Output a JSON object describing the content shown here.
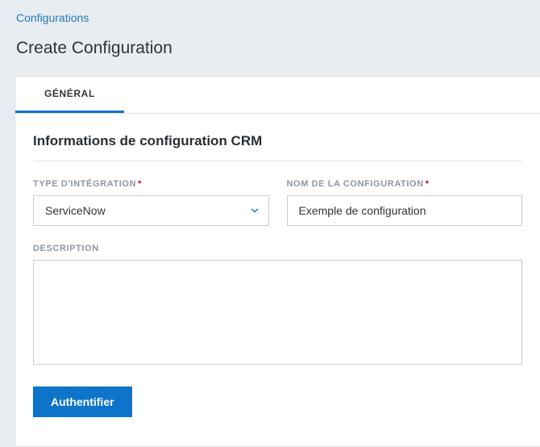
{
  "breadcrumb": {
    "label": "Configurations"
  },
  "page": {
    "title": "Create Configuration"
  },
  "tabs": {
    "general": "GÉNÉRAL"
  },
  "section": {
    "title": "Informations de configuration CRM"
  },
  "fields": {
    "integration_type": {
      "label": "TYPE D'INTÉGRATION",
      "value": "ServiceNow"
    },
    "config_name": {
      "label": "NOM DE LA CONFIGURATION",
      "value": "Exemple de configuration"
    },
    "description": {
      "label": "DESCRIPTION",
      "value": ""
    }
  },
  "buttons": {
    "authenticate": "Authentifier"
  },
  "required_mark": "*"
}
